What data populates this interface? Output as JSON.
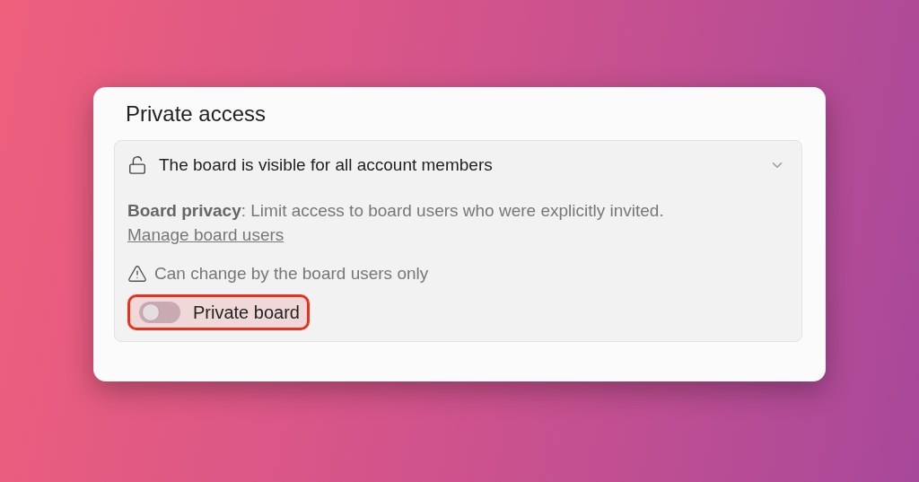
{
  "dialog": {
    "title": "Private access"
  },
  "panel": {
    "expanded": true,
    "summary": "The board is visible for all account members",
    "description": "**Board privacy**: Limit access to board users who were explicitly invited.",
    "link": "Manage board users",
    "warning": "Can change by the board users only",
    "toggle": {
      "label": "Private board",
      "on": false,
      "highlighted": true
    }
  }
}
